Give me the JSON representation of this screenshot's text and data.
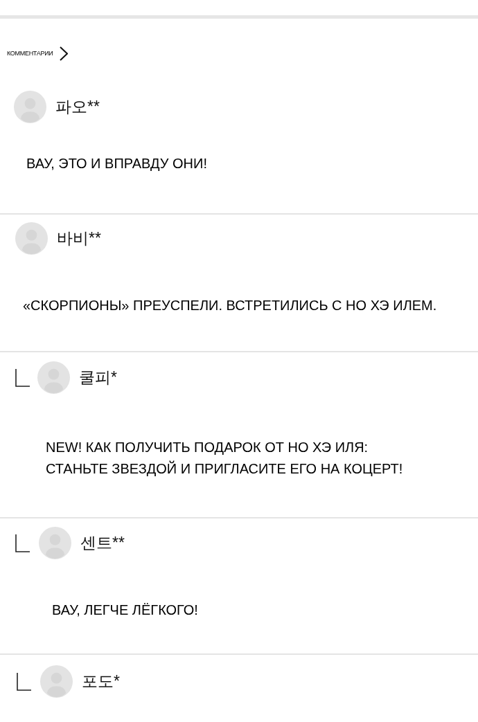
{
  "header": {
    "label": "КОММЕНТАРИИ"
  },
  "comments": [
    {
      "author": "파오**",
      "text": "ВАУ, ЭТО И ВПРАВДУ ОНИ!"
    },
    {
      "author": "바비**",
      "text": "«СКОРПИОНЫ» ПРЕУСПЕЛИ. ВСТРЕТИЛИСЬ С НО ХЭ ИЛЕМ.",
      "replies": [
        {
          "author": "쿨피*",
          "text": "NEW! КАК ПОЛУЧИТЬ ПОДАРОК ОТ НО ХЭ ИЛЯ:\nСТАНЬТЕ ЗВЕЗДОЙ И ПРИГЛАСИТЕ ЕГО НА КОЦЕРТ!"
        },
        {
          "author": "센트**",
          "text": "ВАУ, ЛЕГЧЕ ЛЁГКОГО!"
        },
        {
          "author": "포도*"
        }
      ]
    }
  ]
}
